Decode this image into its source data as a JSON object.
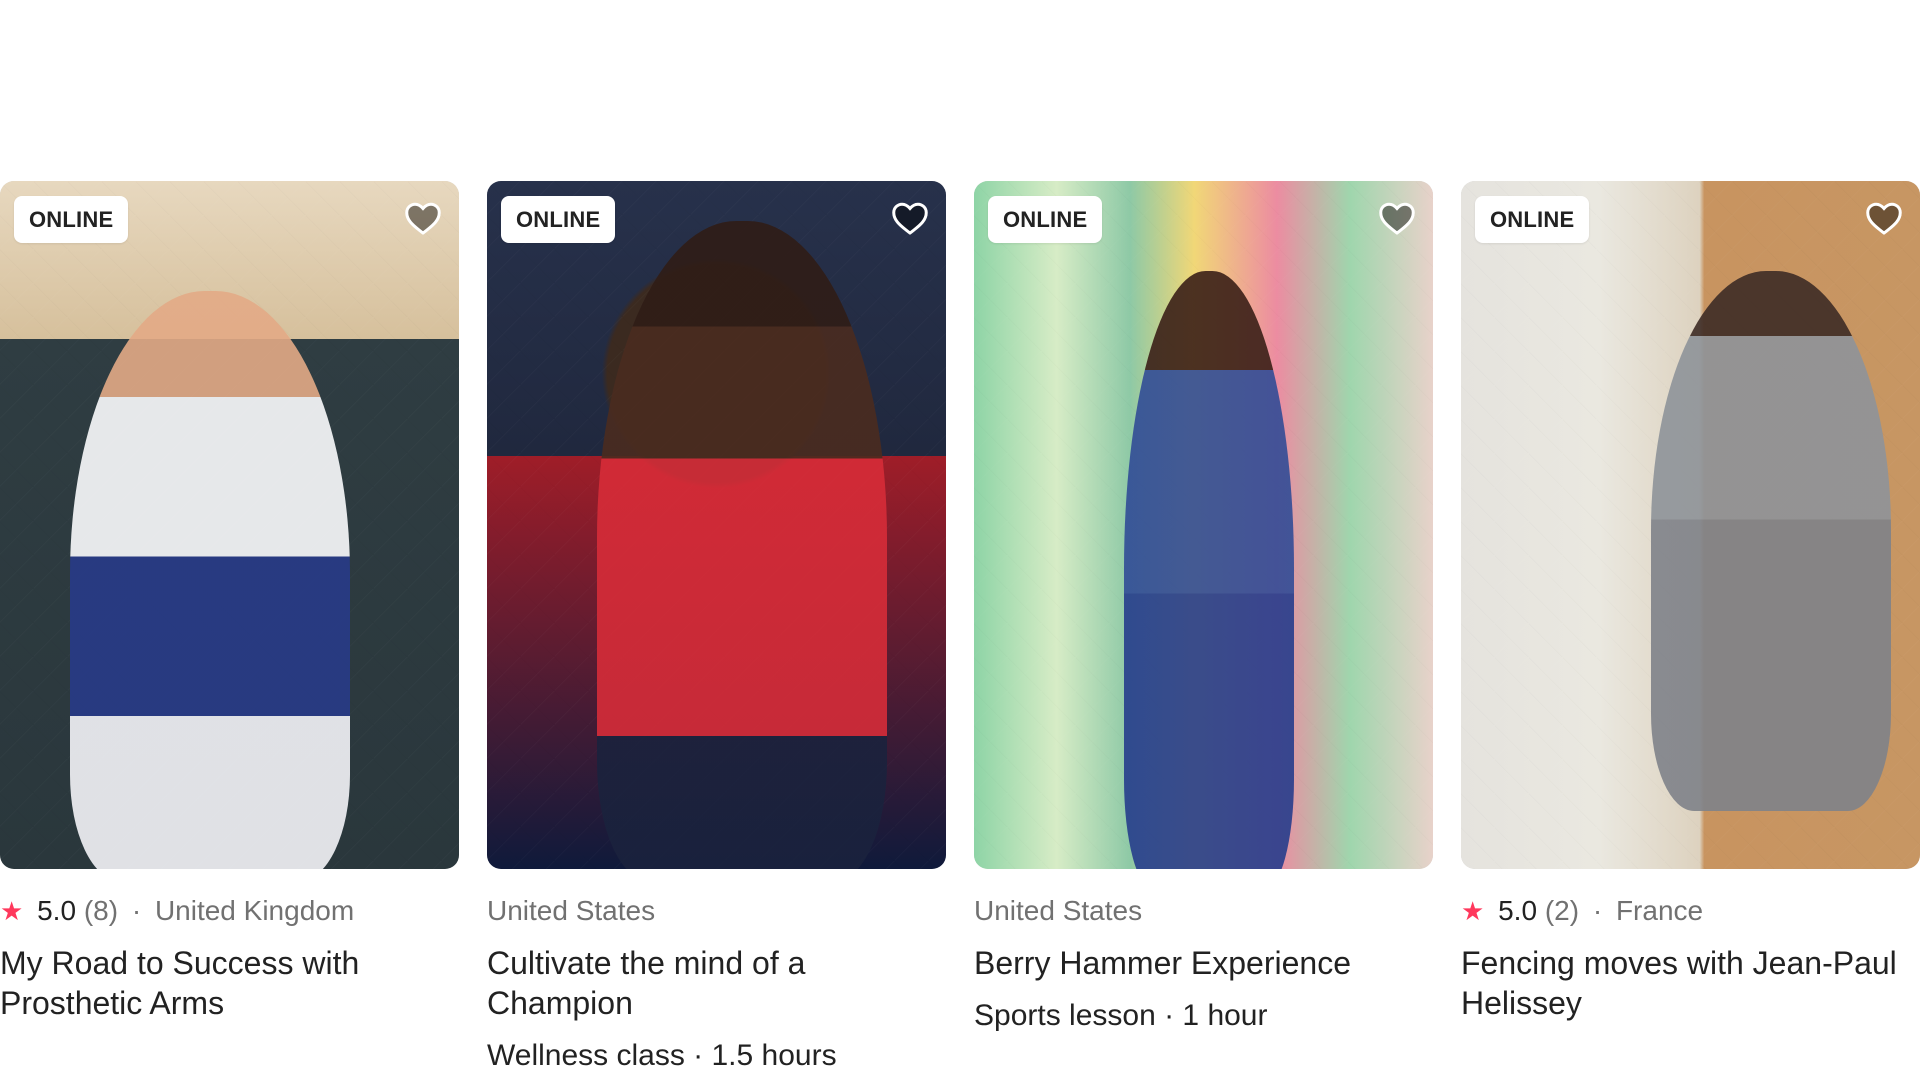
{
  "cards": [
    {
      "badge": "ONLINE",
      "rating": "5.0",
      "reviews": "(8)",
      "location": "United Kingdom",
      "title": "My Road to Success with Prosthetic Arms",
      "subtitle": ""
    },
    {
      "badge": "ONLINE",
      "rating": "",
      "reviews": "",
      "location": "United States",
      "title": "Cultivate the mind of a Champion",
      "subtitle": "Wellness class · 1.5 hours"
    },
    {
      "badge": "ONLINE",
      "rating": "",
      "reviews": "",
      "location": "United States",
      "title": "Berry Hammer Experience",
      "subtitle": "Sports lesson · 1 hour"
    },
    {
      "badge": "ONLINE",
      "rating": "5.0",
      "reviews": "(2)",
      "location": "France",
      "title": "Fencing moves with Jean-Paul Helissey",
      "subtitle": ""
    }
  ],
  "icons": {
    "heart": "heart-icon",
    "star": "star-icon"
  },
  "colors": {
    "accent": "#ff385c",
    "text": "#222222",
    "muted": "#717171"
  }
}
